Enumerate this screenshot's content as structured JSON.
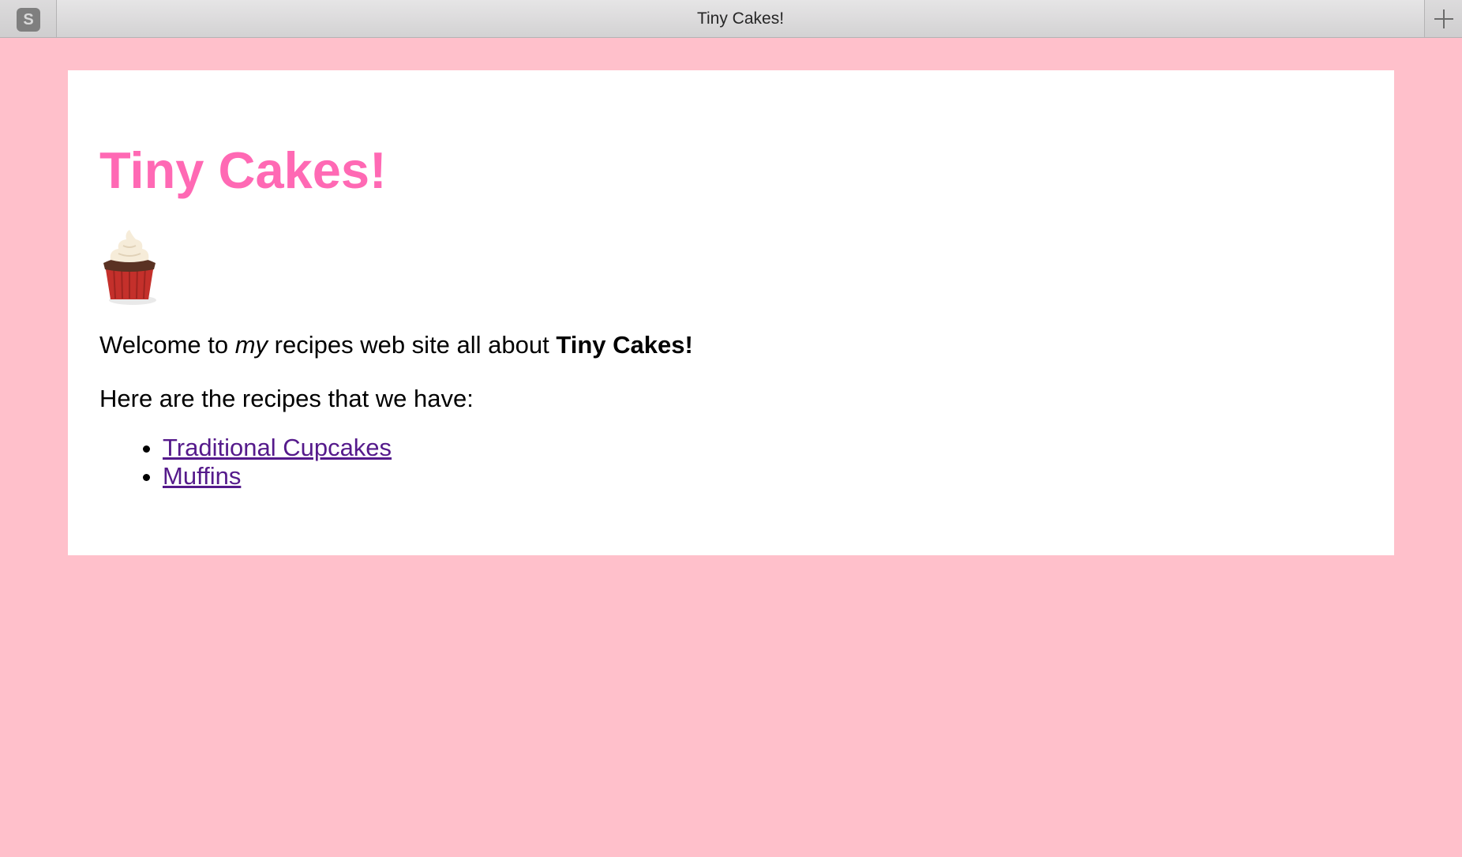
{
  "window": {
    "tab_title": "Tiny Cakes!",
    "left_icon": "s-app-icon",
    "right_icon": "plus-icon"
  },
  "page": {
    "heading": "Tiny Cakes!",
    "image": "cupcake-icon",
    "intro_pre": "Welcome to ",
    "intro_em": "my",
    "intro_mid": " recipes web site all about ",
    "intro_strong": "Tiny Cakes!",
    "lead": "Here are the recipes that we have:",
    "recipes": [
      {
        "label": "Traditional Cupcakes"
      },
      {
        "label": "Muffins"
      }
    ]
  },
  "colors": {
    "background": "#ffc0cb",
    "heading": "#ff69b4",
    "link_visited": "#551a8b"
  }
}
